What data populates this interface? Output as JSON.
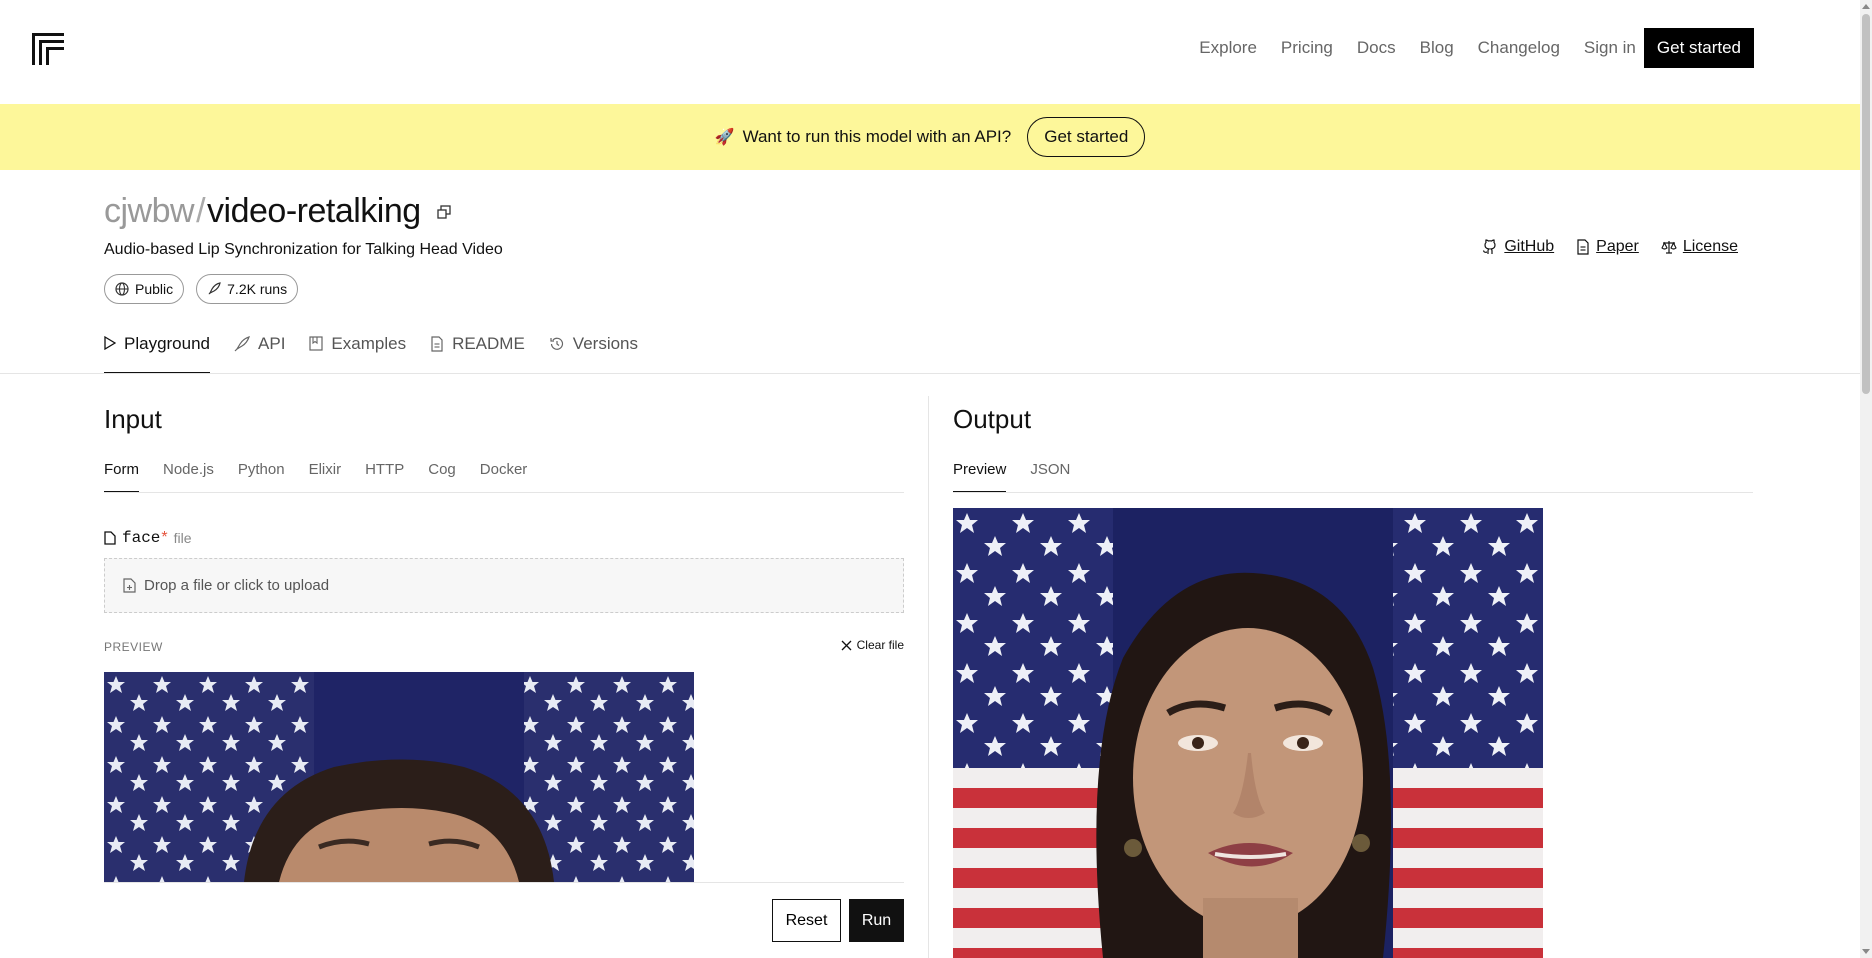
{
  "nav": {
    "links": [
      "Explore",
      "Pricing",
      "Docs",
      "Blog",
      "Changelog",
      "Sign in"
    ],
    "cta": "Get started"
  },
  "banner": {
    "icon": "rocket-icon",
    "text": "Want to run this model with an API?",
    "button": "Get started",
    "bg_color": "#fdf79a"
  },
  "model": {
    "owner": "cjwbw",
    "separator": "/",
    "name": "video-retalking",
    "description": "Audio-based Lip Synchronization for Talking Head Video",
    "visibility": "Public",
    "runs": "7.2K runs",
    "links": {
      "github": "GitHub",
      "paper": "Paper",
      "license": "License"
    }
  },
  "tabs": {
    "playground": "Playground",
    "api": "API",
    "examples": "Examples",
    "readme": "README",
    "versions": "Versions"
  },
  "input": {
    "title": "Input",
    "subtabs": [
      "Form",
      "Node.js",
      "Python",
      "Elixir",
      "HTTP",
      "Cog",
      "Docker"
    ],
    "field": {
      "name": "face",
      "required_mark": "*",
      "type": "file"
    },
    "dropzone_text": "Drop a file or click to upload",
    "preview_label": "PREVIEW",
    "clear_label": "Clear file",
    "reset_label": "Reset",
    "run_label": "Run"
  },
  "output": {
    "title": "Output",
    "subtabs": [
      "Preview",
      "JSON"
    ]
  }
}
